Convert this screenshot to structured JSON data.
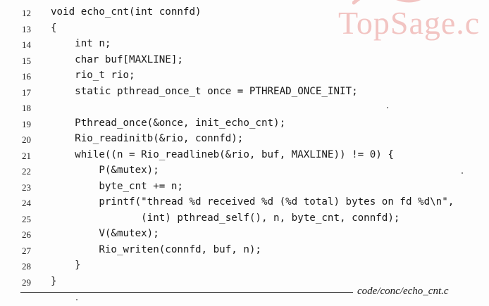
{
  "watermark": {
    "text": "TopSage.c",
    "color": "#f2c4c2"
  },
  "code": {
    "lines": [
      {
        "n": "12",
        "text": "void echo_cnt(int connfd)"
      },
      {
        "n": "13",
        "text": "{"
      },
      {
        "n": "14",
        "text": "    int n;"
      },
      {
        "n": "15",
        "text": "    char buf[MAXLINE];"
      },
      {
        "n": "16",
        "text": "    rio_t rio;"
      },
      {
        "n": "17",
        "text": "    static pthread_once_t once = PTHREAD_ONCE_INIT;"
      },
      {
        "n": "18",
        "text": ""
      },
      {
        "n": "19",
        "text": "    Pthread_once(&once, init_echo_cnt);"
      },
      {
        "n": "20",
        "text": "    Rio_readinitb(&rio, connfd);"
      },
      {
        "n": "21",
        "text": "    while((n = Rio_readlineb(&rio, buf, MAXLINE)) != 0) {"
      },
      {
        "n": "22",
        "text": "        P(&mutex);"
      },
      {
        "n": "23",
        "text": "        byte_cnt += n;"
      },
      {
        "n": "24",
        "text": "        printf(\"thread %d received %d (%d total) bytes on fd %d\\n\","
      },
      {
        "n": "25",
        "text": "               (int) pthread_self(), n, byte_cnt, connfd);"
      },
      {
        "n": "26",
        "text": "        V(&mutex);"
      },
      {
        "n": "27",
        "text": "        Rio_writen(connfd, buf, n);"
      },
      {
        "n": "28",
        "text": "    }"
      },
      {
        "n": "29",
        "text": "}"
      }
    ]
  },
  "footer": {
    "filename": "code/conc/echo_cnt.c"
  }
}
